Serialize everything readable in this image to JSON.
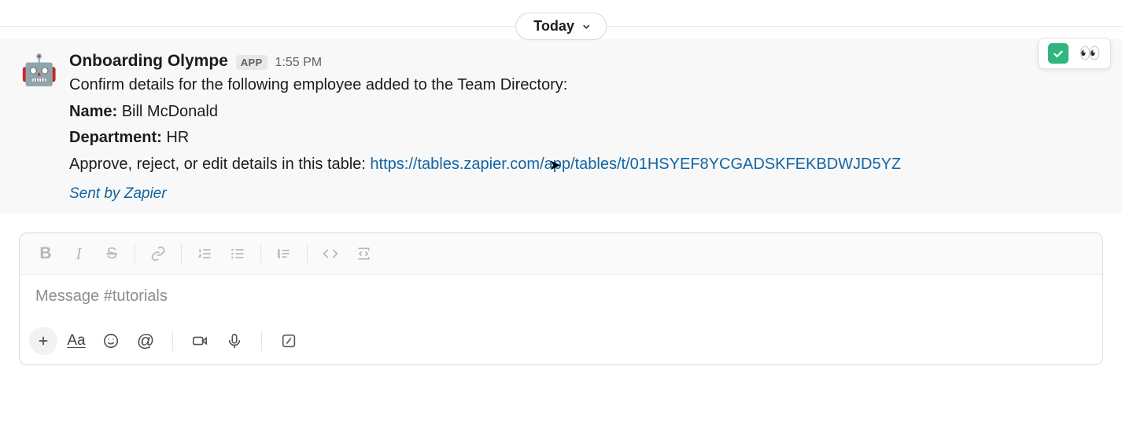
{
  "date_divider": {
    "label": "Today"
  },
  "message": {
    "avatar_emoji": "🤖",
    "sender": "Onboarding Olympe",
    "app_badge": "APP",
    "timestamp": "1:55 PM",
    "line_intro": "Confirm details for the following employee added to the Team Directory:",
    "name_label": "Name:",
    "name_value": "Bill McDonald",
    "department_label": "Department:",
    "department_value": "HR",
    "action_line": "Approve, reject, or edit details in this table: ",
    "link_text": "https://tables.zapier.com/app/tables/t/01HSYEF8YCGADSKFEKBDWJD5YZ",
    "attribution": "Sent by Zapier"
  },
  "reactions": {
    "check": "white_check_mark",
    "eyes": "👀"
  },
  "composer": {
    "placeholder": "Message #tutorials"
  }
}
